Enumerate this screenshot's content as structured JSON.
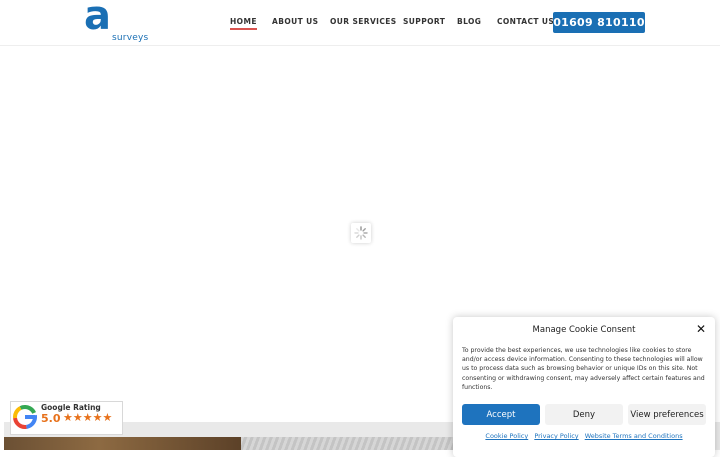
{
  "logo": {
    "mark": "a",
    "text": "surveys"
  },
  "nav": {
    "items": [
      {
        "label": "HOME",
        "active": true
      },
      {
        "label": "ABOUT US"
      },
      {
        "label": "OUR SERVICES"
      },
      {
        "label": "SUPPORT"
      },
      {
        "label": "BLOG"
      },
      {
        "label": "CONTACT US"
      }
    ],
    "phone": "01609 810110"
  },
  "colors": {
    "brand": "#1a6fb4",
    "active_underline": "#d9534f",
    "rating": "#e7711b"
  },
  "rating": {
    "title": "Google Rating",
    "score": "5.0",
    "stars": 5,
    "icon": "google-icon"
  },
  "cookie": {
    "title": "Manage Cookie Consent",
    "body": "To provide the best experiences, we use technologies like cookies to store and/or access device information. Consenting to these technologies will allow us to process data such as browsing behavior or unique IDs on this site. Not consenting or withdrawing consent, may adversely affect certain features and functions.",
    "accept": "Accept",
    "deny": "Deny",
    "preferences": "View preferences",
    "links": [
      "Cookie Policy",
      "Privacy Policy",
      "Website Terms and Conditions"
    ]
  }
}
